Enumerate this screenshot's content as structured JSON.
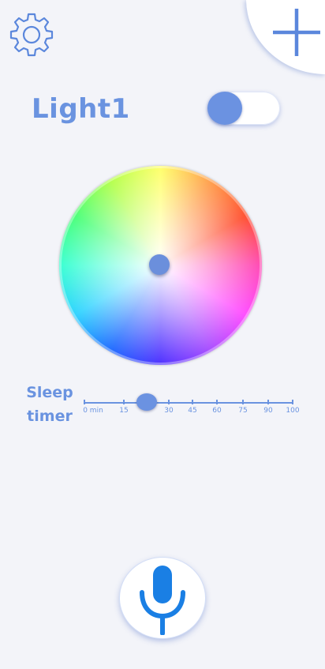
{
  "header": {
    "settings_icon": "gear-icon",
    "add_icon": "plus-icon"
  },
  "light": {
    "name": "Light1",
    "power_on": true
  },
  "color_wheel": {
    "selected_hex": "#ffffff"
  },
  "sleep_timer": {
    "label_line1": "Sleep",
    "label_line2": "timer",
    "ticks": [
      "0 min",
      "15",
      "30",
      "45",
      "60",
      "75",
      "90",
      "100"
    ],
    "value_percent": 0.3
  },
  "voice": {
    "icon": "microphone-icon"
  },
  "colors": {
    "accent": "#6a93e0",
    "background": "#f3f4f9",
    "mic": "#1a7fe4"
  }
}
